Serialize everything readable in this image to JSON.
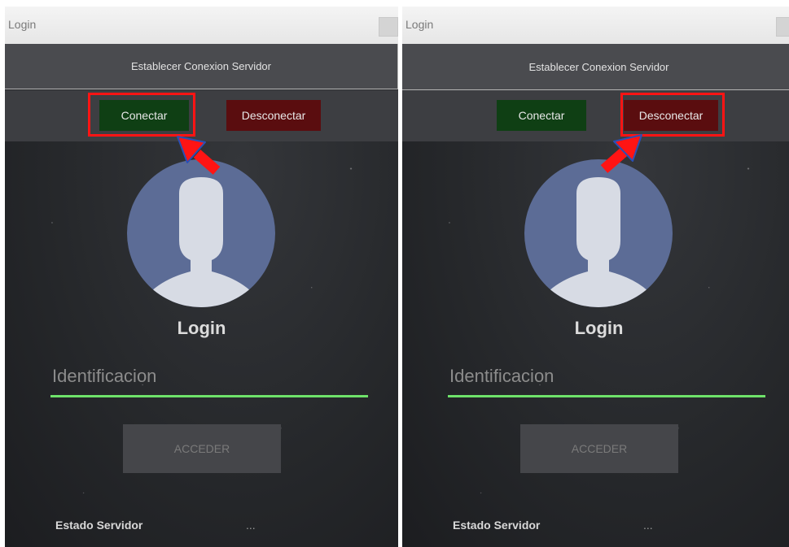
{
  "panels": [
    {
      "window_title": "Login",
      "header": "Establecer Conexion Servidor",
      "connect_label": "Conectar",
      "disconnect_label": "Desconectar",
      "highlighted_button": "Conectar",
      "login_heading": "Login",
      "id_placeholder": "Identificacion",
      "access_label": "ACCEDER",
      "status_label": "Estado Servidor",
      "status_value": "..."
    },
    {
      "window_title": "Login",
      "header": "Establecer Conexion Servidor",
      "connect_label": "Conectar",
      "disconnect_label": "Desconectar",
      "highlighted_button": "Desconectar",
      "login_heading": "Login",
      "id_placeholder": "Identificacion",
      "access_label": "ACCEDER",
      "status_label": "Estado Servidor",
      "status_value": "..."
    }
  ],
  "colors": {
    "connect_bg": "#0f3f14",
    "disconnect_bg": "#5a0d0f",
    "highlight": "#ff1414",
    "input_underline": "#6ee26a",
    "avatar_bg": "#5c6c96",
    "silhouette": "#d7dbe4"
  },
  "icons": {
    "avatar": "user-silhouette-icon",
    "annotation": "red-arrow-icon"
  }
}
